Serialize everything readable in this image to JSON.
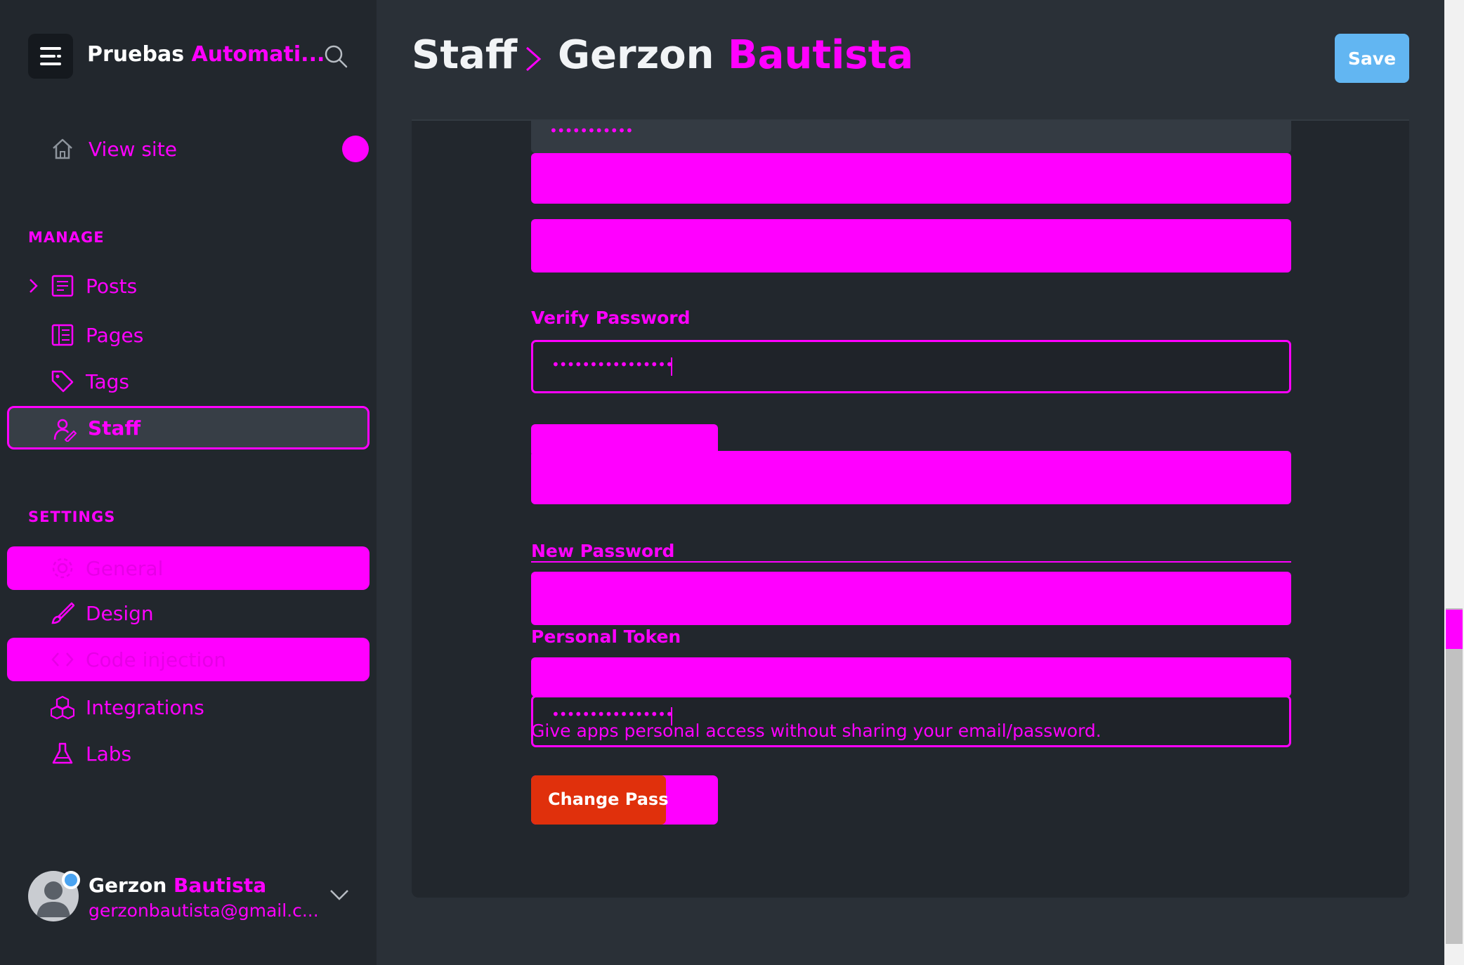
{
  "sidebar": {
    "brand": {
      "name": "Pruebas",
      "name_obscured": "Automati..."
    },
    "view_site": {
      "label": "View site"
    },
    "manage_label": "MANAGE",
    "manage_items": [
      {
        "label": "Posts",
        "icon": "posts-icon"
      },
      {
        "label": "Pages",
        "icon": "pages-icon"
      },
      {
        "label": "Tags",
        "icon": "tag-icon"
      },
      {
        "label": "Staff",
        "icon": "staff-icon",
        "active": true
      }
    ],
    "settings_label": "SETTINGS",
    "settings_items": [
      {
        "label": "General",
        "icon": "gear-icon"
      },
      {
        "label": "Design",
        "icon": "brush-icon"
      },
      {
        "label": "Code injection",
        "icon": "code-icon"
      },
      {
        "label": "Integrations",
        "icon": "integrations-icon"
      },
      {
        "label": "Labs",
        "icon": "flask-icon"
      }
    ],
    "user": {
      "first_name": "Gerzon",
      "last_name": "Bautista",
      "email": "gerzonbautista@gmail.c..."
    }
  },
  "header": {
    "crumb_root": "Staff",
    "crumb_first": "Gerzon",
    "crumb_last": "Bautista",
    "save_label": "Save"
  },
  "form": {
    "top_input_dots": "•••••••••••",
    "verify_password_label": "Verify Password",
    "verify_password_dots": "••••••••••••••••",
    "new_password_label": "New Password",
    "personal_token_label": "Personal Token",
    "personal_token_dots": "••••••••••••••••",
    "personal_token_help": "Give apps personal access without sharing your email/password.",
    "change_password_label": "Change Pass"
  },
  "colors": {
    "accent": "#ff00ff",
    "save_button": "#62b6f2",
    "danger_button": "#e0300c",
    "sidebar_bg": "#22272d",
    "main_bg": "#2a3037"
  }
}
